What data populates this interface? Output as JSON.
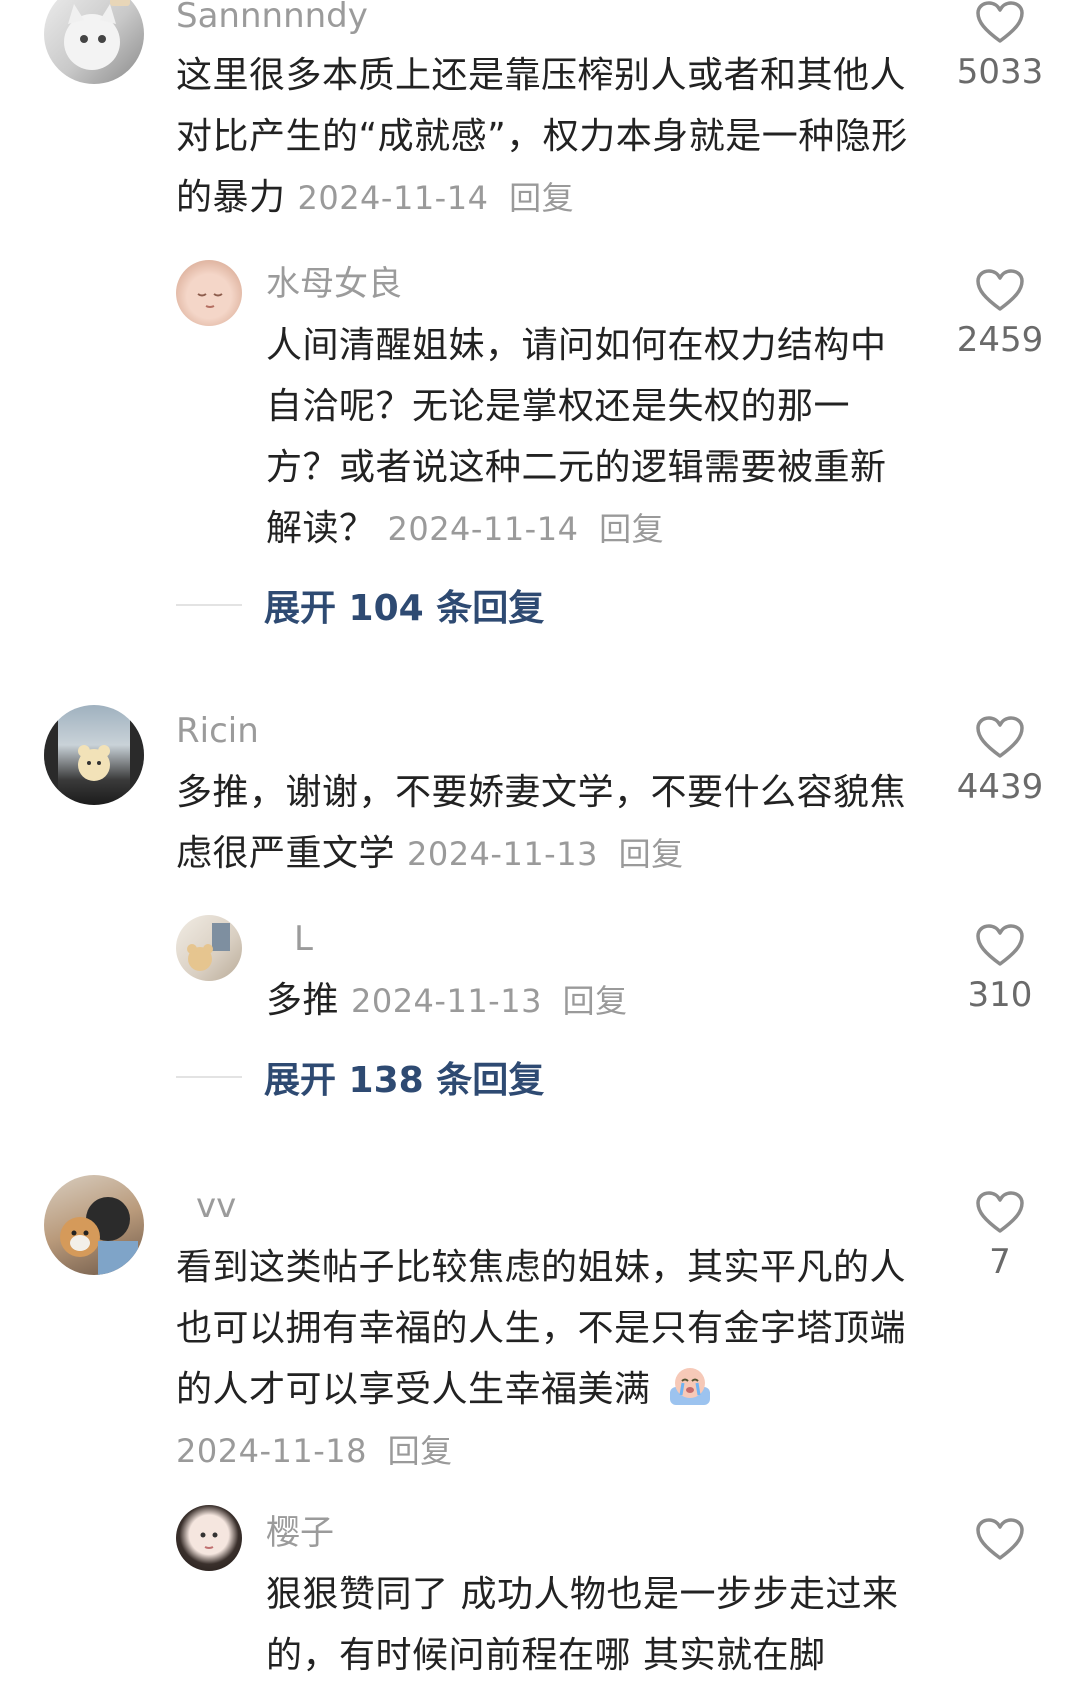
{
  "comments": [
    {
      "username": "Sannnnndy",
      "text": "这里很多本质上还是靠压榨别人或者和其他人对比产生的“成就感”，权力本身就是一种隐形的暴力",
      "date": "2024-11-14",
      "reply_label": "回复",
      "likes": "5033",
      "replies": [
        {
          "username": "水母女良",
          "text": "人间清醒姐妹，请问如何在权力结构中自洽呢？无论是掌权还是失权的那一方？或者说这种二元的逻辑需要被重新解读？",
          "date": "2024-11-14",
          "reply_label": "回复",
          "likes": "2459"
        }
      ],
      "expand_label": "展开 104 条回复"
    },
    {
      "username": "Ricin",
      "text": "多推，谢谢，不要娇妻文学，不要什么容貌焦虑很严重文学",
      "date": "2024-11-13",
      "reply_label": "回复",
      "likes": "4439",
      "replies": [
        {
          "username": "L",
          "text": "多推",
          "date": "2024-11-13",
          "reply_label": "回复",
          "likes": "310"
        }
      ],
      "expand_label": "展开 138 条回复"
    },
    {
      "username": "vv",
      "text": "看到这类帖子比较焦虑的姐妹，其实平凡的人也可以拥有幸福的人生，不是只有金字塔顶端的人才可以享受人生幸福美满",
      "emoji": "crying-face-emoji",
      "date": "2024-11-18",
      "reply_label": "回复",
      "likes": "7",
      "replies": [
        {
          "username": "樱子",
          "text": "狠狠赞同了 成功人物也是一步步走过来的，有时候问前程在哪 其实就在脚",
          "likes": ""
        }
      ]
    }
  ],
  "icons": {
    "like": "heart-outline-icon"
  },
  "colors": {
    "username": "#9b9b9b",
    "meta": "#9a9a9a",
    "expand": "#2e4a72",
    "heart": "#8c8c8c"
  }
}
